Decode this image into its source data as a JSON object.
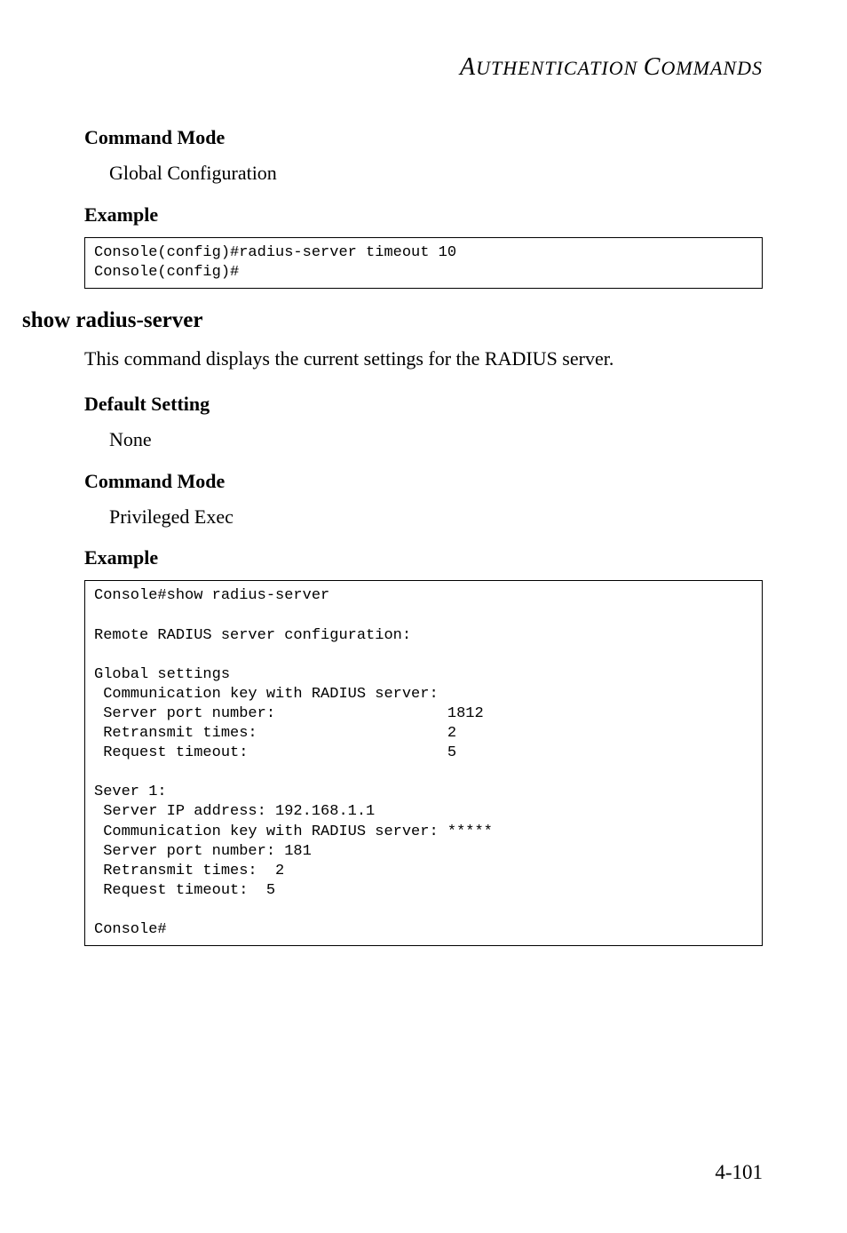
{
  "header": {
    "title": "AUTHENTICATION COMMANDS"
  },
  "section1": {
    "command_mode_heading": "Command Mode",
    "command_mode_text": "Global Configuration",
    "example_heading": "Example",
    "code": "Console(config)#radius-server timeout 10\nConsole(config)#"
  },
  "section2": {
    "title": "show radius-server",
    "description": "This command displays the current settings for the RADIUS server.",
    "default_setting_heading": "Default Setting",
    "default_setting_text": "None",
    "command_mode_heading": "Command Mode",
    "command_mode_text": "Privileged Exec",
    "example_heading": "Example",
    "code": "Console#show radius-server\n\nRemote RADIUS server configuration:\n\nGlobal settings\n Communication key with RADIUS server:\n Server port number:                   1812\n Retransmit times:                     2\n Request timeout:                      5\n\nSever 1:\n Server IP address: 192.168.1.1\n Communication key with RADIUS server: *****\n Server port number: 181\n Retransmit times:  2\n Request timeout:  5\n\nConsole#"
  },
  "page_number": "4-101"
}
